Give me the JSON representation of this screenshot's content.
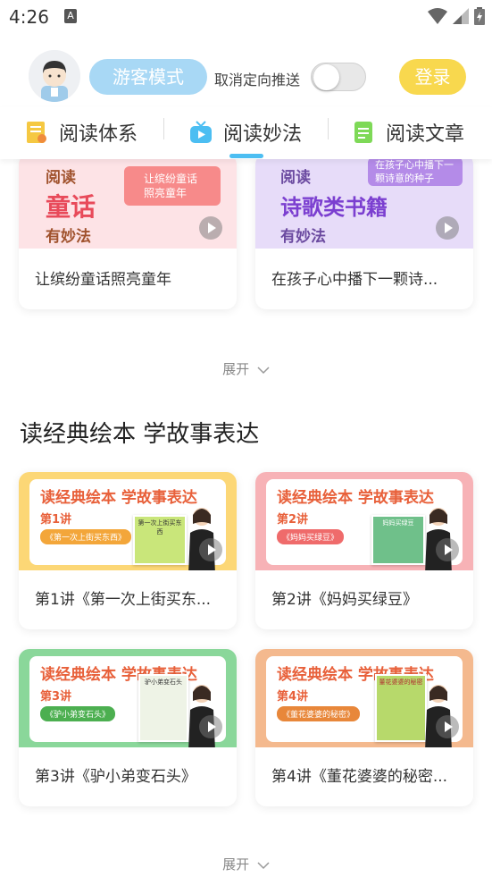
{
  "status": {
    "time": "4:26",
    "notif_icon": "A"
  },
  "header": {
    "guest_mode": "游客模式",
    "push_label": "取消定向推送",
    "push_enabled": false,
    "login": "登录"
  },
  "tabs": [
    {
      "label": "阅读体系",
      "icon": "reading-system-icon"
    },
    {
      "label": "阅读妙法",
      "icon": "tv-icon",
      "active": true
    },
    {
      "label": "阅读文章",
      "icon": "article-icon"
    }
  ],
  "top_cards": [
    {
      "caption": "让缤纷童话照亮童年",
      "thumb": {
        "t1": "阅读",
        "t2": "童话",
        "t3": "有妙法",
        "bubble": "让缤纷童话照亮童年"
      }
    },
    {
      "caption": "在孩子心中播下一颗诗...",
      "thumb": {
        "t1": "阅读",
        "t2": "诗歌类书籍",
        "t3": "有妙法",
        "bubble": "在孩子心中播下一颗诗意的种子"
      }
    }
  ],
  "expand_label": "展开",
  "section": {
    "title": "读经典绘本 学故事表达",
    "cards": [
      {
        "banner": "读经典绘本  学故事表达",
        "lesson": "第1讲",
        "book": "《第一次上街买东西》",
        "caption": "第1讲《第一次上街买东...",
        "book_cover_title": "第一次上街买东西"
      },
      {
        "banner": "读经典绘本  学故事表达",
        "lesson": "第2讲",
        "book": "《妈妈买绿豆》",
        "caption": "第2讲《妈妈买绿豆》",
        "book_cover_title": "妈妈买绿豆"
      },
      {
        "banner": "读经典绘本  学故事表达",
        "lesson": "第3讲",
        "book": "《驴小弟变石头》",
        "caption": "第3讲《驴小弟变石头》",
        "book_cover_title": "驴小弟变石头"
      },
      {
        "banner": "读经典绘本  学故事表达",
        "lesson": "第4讲",
        "book": "《董花婆婆的秘密》",
        "caption": "第4讲《董花婆婆的秘密...",
        "book_cover_title": "董花婆婆的秘密"
      }
    ]
  },
  "colors": {
    "guest_bg": "#a8d8f5",
    "login_bg": "#f8d84e",
    "tab_indicator": "#4cbef2",
    "card1_bg": "#fde3e6",
    "card2_bg": "#e7dcf9",
    "lesson1_bg": "#fcd776",
    "lesson2_bg": "#f7b2b6",
    "lesson3_bg": "#8ad79a",
    "lesson4_bg": "#f4b98e"
  }
}
